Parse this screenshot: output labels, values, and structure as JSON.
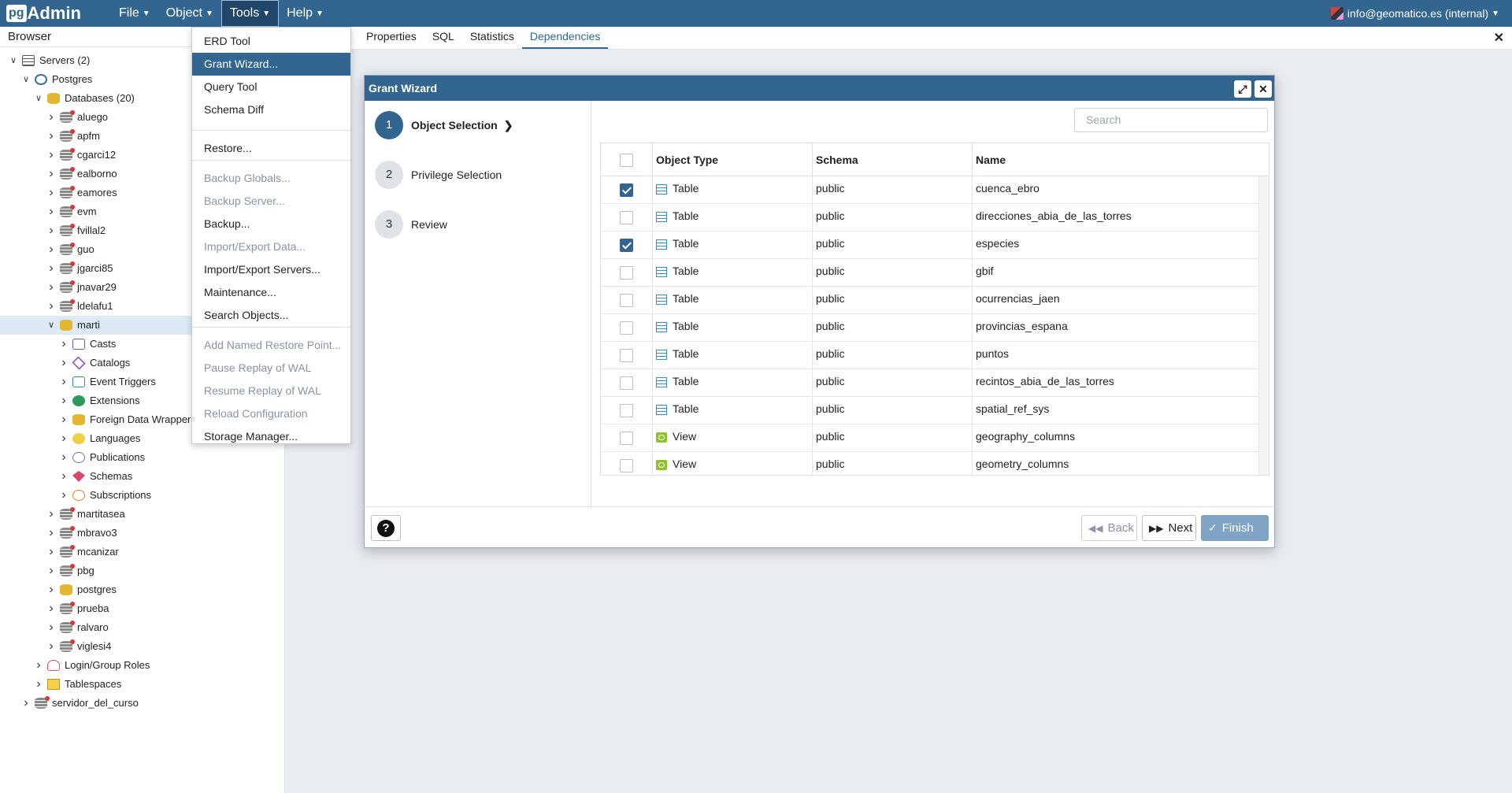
{
  "navbar": {
    "logo_pg": "pg",
    "logo_admin": "Admin",
    "menus": [
      "File",
      "Object",
      "Tools",
      "Help"
    ],
    "user": "info@geomatico.es (internal)"
  },
  "browser": {
    "title": "Browser",
    "tree": [
      {
        "label": "Servers (2)",
        "icon": "server-icon",
        "expanded": true
      },
      {
        "label": "Postgres",
        "icon": "postgres-server-icon",
        "expanded": true
      },
      {
        "label": "Databases (20)",
        "icon": "databases-icon",
        "expanded": true
      },
      {
        "label": "aluego",
        "icon": "database-disconnected-icon"
      },
      {
        "label": "apfm",
        "icon": "database-disconnected-icon"
      },
      {
        "label": "cgarci12",
        "icon": "database-disconnected-icon"
      },
      {
        "label": "ealborno",
        "icon": "database-disconnected-icon"
      },
      {
        "label": "eamores",
        "icon": "database-disconnected-icon"
      },
      {
        "label": "evm",
        "icon": "database-disconnected-icon"
      },
      {
        "label": "fvillal2",
        "icon": "database-disconnected-icon"
      },
      {
        "label": "guo",
        "icon": "database-disconnected-icon"
      },
      {
        "label": "jgarci85",
        "icon": "database-disconnected-icon"
      },
      {
        "label": "jnavar29",
        "icon": "database-disconnected-icon"
      },
      {
        "label": "ldelafu1",
        "icon": "database-disconnected-icon"
      },
      {
        "label": "marti",
        "icon": "database-connected-icon",
        "expanded": true,
        "selected": true
      },
      {
        "label": "Casts",
        "icon": "casts-icon"
      },
      {
        "label": "Catalogs",
        "icon": "catalogs-icon"
      },
      {
        "label": "Event Triggers",
        "icon": "event-triggers-icon"
      },
      {
        "label": "Extensions",
        "icon": "extensions-icon"
      },
      {
        "label": "Foreign Data Wrappers",
        "icon": "foreign-data-wrappers-icon"
      },
      {
        "label": "Languages",
        "icon": "languages-icon"
      },
      {
        "label": "Publications",
        "icon": "publications-icon"
      },
      {
        "label": "Schemas",
        "icon": "schemas-icon"
      },
      {
        "label": "Subscriptions",
        "icon": "subscriptions-icon"
      },
      {
        "label": "martitasea",
        "icon": "database-disconnected-icon"
      },
      {
        "label": "mbravo3",
        "icon": "database-disconnected-icon"
      },
      {
        "label": "mcanizar",
        "icon": "database-disconnected-icon"
      },
      {
        "label": "pbg",
        "icon": "database-disconnected-icon"
      },
      {
        "label": "postgres",
        "icon": "database-connected-icon"
      },
      {
        "label": "prueba",
        "icon": "database-disconnected-icon"
      },
      {
        "label": "ralvaro",
        "icon": "database-disconnected-icon"
      },
      {
        "label": "viglesi4",
        "icon": "database-disconnected-icon"
      },
      {
        "label": "Login/Group Roles",
        "icon": "login-roles-icon"
      },
      {
        "label": "Tablespaces",
        "icon": "tablespaces-icon"
      },
      {
        "label": "servidor_del_curso",
        "icon": "server-disconnected-icon"
      }
    ]
  },
  "tools_menu": {
    "items": [
      {
        "label": "ERD Tool",
        "disabled": false
      },
      {
        "label": "Grant Wizard...",
        "disabled": false,
        "active": true
      },
      {
        "label": "Query Tool",
        "disabled": false
      },
      {
        "label": "Schema Diff",
        "disabled": false
      },
      {
        "label": "Restore...",
        "disabled": false
      },
      {
        "label": "Backup Globals...",
        "disabled": true
      },
      {
        "label": "Backup Server...",
        "disabled": true
      },
      {
        "label": "Backup...",
        "disabled": false
      },
      {
        "label": "Import/Export Data...",
        "disabled": true
      },
      {
        "label": "Import/Export Servers...",
        "disabled": false
      },
      {
        "label": "Maintenance...",
        "disabled": false
      },
      {
        "label": "Search Objects...",
        "disabled": false
      },
      {
        "label": "Add Named Restore Point...",
        "disabled": true
      },
      {
        "label": "Pause Replay of WAL",
        "disabled": true
      },
      {
        "label": "Resume Replay of WAL",
        "disabled": true
      },
      {
        "label": "Reload Configuration",
        "disabled": true
      },
      {
        "label": "Storage Manager...",
        "disabled": false
      }
    ]
  },
  "main_tabs": [
    "Properties",
    "SQL",
    "Statistics",
    "Dependencies"
  ],
  "main_tabs_active": "Dependencies",
  "dialog": {
    "title": "Grant Wizard",
    "steps": [
      {
        "num": "1",
        "label": "Object Selection"
      },
      {
        "num": "2",
        "label": "Privilege Selection"
      },
      {
        "num": "3",
        "label": "Review"
      }
    ],
    "current_step": 1,
    "search_placeholder": "Search",
    "columns": [
      "Object Type",
      "Schema",
      "Name"
    ],
    "rows": [
      {
        "checked": true,
        "type": "Table",
        "schema": "public",
        "name": "cuenca_ebro"
      },
      {
        "checked": false,
        "type": "Table",
        "schema": "public",
        "name": "direcciones_abia_de_las_torres"
      },
      {
        "checked": true,
        "type": "Table",
        "schema": "public",
        "name": "especies"
      },
      {
        "checked": false,
        "type": "Table",
        "schema": "public",
        "name": "gbif"
      },
      {
        "checked": false,
        "type": "Table",
        "schema": "public",
        "name": "ocurrencias_jaen"
      },
      {
        "checked": false,
        "type": "Table",
        "schema": "public",
        "name": "provincias_espana"
      },
      {
        "checked": false,
        "type": "Table",
        "schema": "public",
        "name": "puntos"
      },
      {
        "checked": false,
        "type": "Table",
        "schema": "public",
        "name": "recintos_abia_de_las_torres"
      },
      {
        "checked": false,
        "type": "Table",
        "schema": "public",
        "name": "spatial_ref_sys"
      },
      {
        "checked": false,
        "type": "View",
        "schema": "public",
        "name": "geography_columns"
      },
      {
        "checked": false,
        "type": "View",
        "schema": "public",
        "name": "geometry_columns"
      }
    ],
    "buttons": {
      "back": "Back",
      "next": "Next",
      "finish": "Finish"
    }
  },
  "colors": {
    "brand": "#326690",
    "disabled": "#8a94a2"
  }
}
